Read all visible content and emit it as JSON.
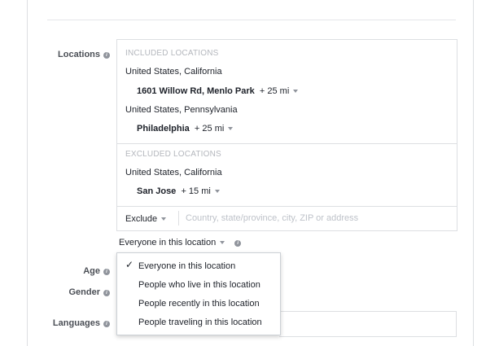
{
  "labels": {
    "locations": "Locations",
    "age": "Age",
    "gender": "Gender",
    "languages": "Languages",
    "info_glyph": "i"
  },
  "included": {
    "header": "INCLUDED LOCATIONS",
    "regions": [
      {
        "region": "United States, California",
        "city": "1601 Willow Rd, Menlo Park",
        "radius": "+  25 mi"
      },
      {
        "region": "United States, Pennsylvania",
        "city": "Philadelphia",
        "radius": "+  25 mi"
      }
    ]
  },
  "excluded": {
    "header": "EXCLUDED LOCATIONS",
    "regions": [
      {
        "region": "United States, California",
        "city": "San Jose",
        "radius": "+  15 mi"
      }
    ]
  },
  "search": {
    "mode_label": "Exclude",
    "placeholder": "Country, state/province, city, ZIP or address"
  },
  "location_type": {
    "selected": "Everyone in this location",
    "options": [
      "Everyone in this location",
      "People who live in this location",
      "People recently in this location",
      "People traveling in this location"
    ],
    "check_glyph": "✓"
  },
  "icons": {
    "info": "info-icon",
    "dropdown": "triangle-down-icon",
    "checkmark": "checkmark-icon"
  },
  "colors": {
    "border": "#dddfe2",
    "muted_text": "#b4b7bd",
    "label_text": "#4b4f56",
    "body_text": "#1d2129"
  }
}
